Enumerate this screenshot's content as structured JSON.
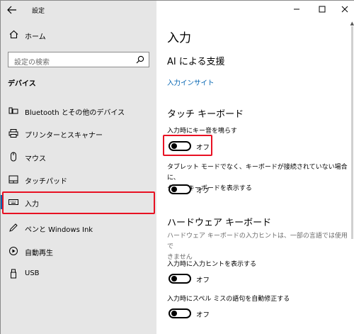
{
  "window": {
    "title": "設定",
    "back": "back-arrow-icon",
    "controls": [
      "minimize-icon",
      "maximize-icon",
      "close-icon"
    ]
  },
  "sidebar": {
    "home_label": "ホーム",
    "search_placeholder": "設定の検索",
    "section_header": "デバイス",
    "items": [
      {
        "label": "Bluetooth とその他のデバイス",
        "icon": "bluetooth-devices-icon"
      },
      {
        "label": "プリンターとスキャナー",
        "icon": "printer-icon"
      },
      {
        "label": "マウス",
        "icon": "mouse-icon"
      },
      {
        "label": "タッチパッド",
        "icon": "touchpad-icon"
      },
      {
        "label": "入力",
        "icon": "keyboard-icon",
        "selected": true
      },
      {
        "label": "ペンと Windows Ink",
        "icon": "pen-icon"
      },
      {
        "label": "自動再生",
        "icon": "autoplay-icon"
      },
      {
        "label": "USB",
        "icon": "usb-icon"
      }
    ]
  },
  "main": {
    "title": "入力",
    "ai_heading": "AI による支援",
    "insights_link": "入力インサイト",
    "touch_keyboard_heading": "タッチ キーボード",
    "touch_settings": [
      {
        "label": "入力時にキー音を鳴らす",
        "state": "オフ"
      },
      {
        "label_line1": "タブレット モードでなく、キーボードが接続されていない場合に、",
        "label_line2": "タッチ キーボードを表示する",
        "state": "オフ"
      }
    ],
    "hardware_keyboard_heading": "ハードウェア キーボード",
    "hardware_desc_line1": "ハードウェア キーボードの入力ヒントは、一部の言語では使用で",
    "hardware_desc_line2": "きません",
    "hardware_settings": [
      {
        "label": "入力時に入力ヒントを表示する",
        "state": "オフ"
      },
      {
        "label": "入力時にスペル ミスの語句を自動修正する",
        "state": "オフ"
      }
    ]
  },
  "colors": {
    "sidebar_bg": "#e6e6e6",
    "accent": "#0063b1",
    "highlight": "#e81123"
  }
}
